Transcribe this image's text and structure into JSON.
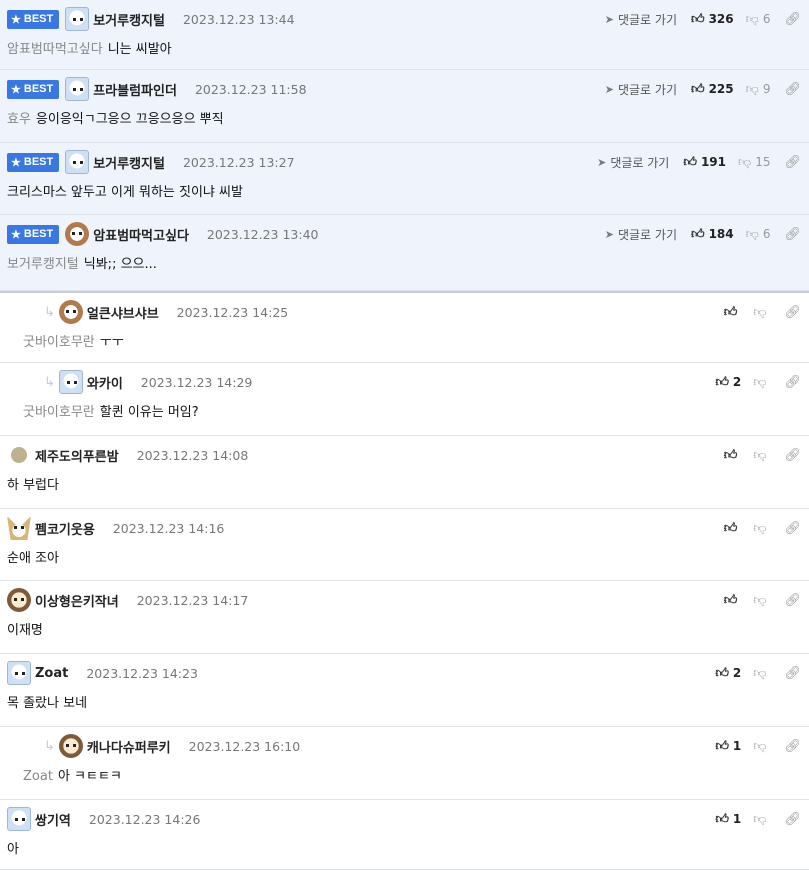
{
  "best_label": "BEST",
  "goto_label": "댓글로 가기",
  "comments": [
    {
      "best": true,
      "nick": "보거루캥지털",
      "date": "2023.12.23 13:44",
      "mention": "암표범따먹고싶다",
      "text": "니는 씨발아",
      "likes": "326",
      "dislikes": "6",
      "avatar": "white"
    },
    {
      "best": true,
      "nick": "프라블럼파인더",
      "date": "2023.12.23 11:58",
      "mention": "효우",
      "text": "응이응익ㄱ그응으 끄응으응으 뿌직",
      "likes": "225",
      "dislikes": "9",
      "avatar": "white"
    },
    {
      "best": true,
      "nick": "보거루캥지털",
      "date": "2023.12.23 13:27",
      "mention": "",
      "text": "크리스마스 앞두고 이게 뭐하는 짓이냐 씨발",
      "likes": "191",
      "dislikes": "15",
      "avatar": "white"
    },
    {
      "best": true,
      "nick": "암표범따먹고싶다",
      "date": "2023.12.23 13:40",
      "mention": "보거루캥지털",
      "text": "닉봐;; 으으...",
      "likes": "184",
      "dislikes": "6",
      "avatar": "dog"
    },
    {
      "reply": true,
      "nick": "얼큰샤브샤브",
      "date": "2023.12.23 14:25",
      "mention": "굿바이호무란",
      "text": "ㅜㅜ",
      "likes": "",
      "dislikes": "",
      "avatar": "dog"
    },
    {
      "reply": true,
      "nick": "와카이",
      "date": "2023.12.23 14:29",
      "mention": "굿바이호무란",
      "text": "할퀸 이유는 머임?",
      "likes": "2",
      "dislikes": "",
      "avatar": "white"
    },
    {
      "nick": "제주도의푸른밤",
      "date": "2023.12.23 14:08",
      "mention": "",
      "text": "하 부럽다",
      "likes": "",
      "dislikes": "",
      "avatar": "dot"
    },
    {
      "nick": "펨코기웃용",
      "date": "2023.12.23 14:16",
      "mention": "",
      "text": "순애 조아",
      "likes": "",
      "dislikes": "",
      "avatar": "fox"
    },
    {
      "nick": "이상형은키작녀",
      "date": "2023.12.23 14:17",
      "mention": "",
      "text": "이재명",
      "likes": "",
      "dislikes": "",
      "avatar": "dog2"
    },
    {
      "nick": "Zoat",
      "date": "2023.12.23 14:23",
      "mention": "",
      "text": "목 졸랐나 보네",
      "likes": "2",
      "dislikes": "",
      "avatar": "white"
    },
    {
      "reply": true,
      "nick": "캐나다슈퍼루키",
      "date": "2023.12.23 16:10",
      "mention": "Zoat",
      "text": "아 ㅋㅌㅌㅋ",
      "likes": "1",
      "dislikes": "",
      "avatar": "dog2"
    },
    {
      "nick": "쌍기역",
      "date": "2023.12.23 14:26",
      "mention": "",
      "text": "아",
      "likes": "1",
      "dislikes": "",
      "avatar": "white"
    }
  ]
}
